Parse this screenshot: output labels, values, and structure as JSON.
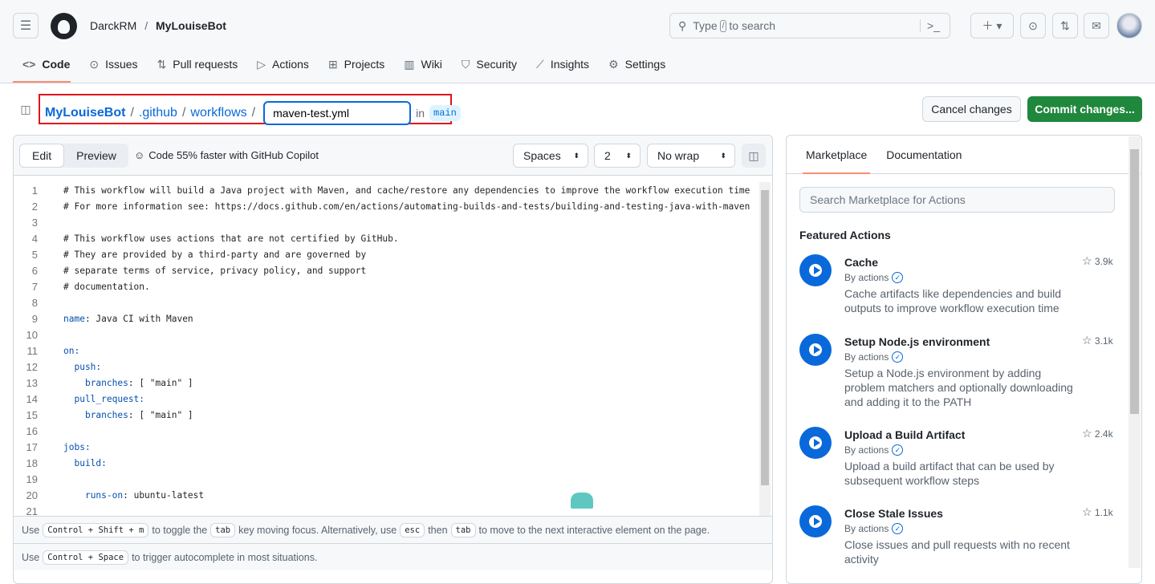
{
  "header": {
    "owner": "DarckRM",
    "repo": "MyLouiseBot",
    "search_pre": "Type",
    "search_key": "/",
    "search_post": "to search"
  },
  "nav": [
    {
      "label": "Code",
      "icon": "code-icon"
    },
    {
      "label": "Issues",
      "icon": "issue-icon"
    },
    {
      "label": "Pull requests",
      "icon": "pull-request-icon"
    },
    {
      "label": "Actions",
      "icon": "play-icon"
    },
    {
      "label": "Projects",
      "icon": "table-icon"
    },
    {
      "label": "Wiki",
      "icon": "book-icon"
    },
    {
      "label": "Security",
      "icon": "shield-icon"
    },
    {
      "label": "Insights",
      "icon": "graph-icon"
    },
    {
      "label": "Settings",
      "icon": "gear-icon"
    }
  ],
  "path": {
    "repo": "MyLouiseBot",
    "dir1": ".github",
    "dir2": "workflows",
    "filename": "maven-test.yml",
    "in": "in",
    "branch": "main"
  },
  "buttons": {
    "cancel": "Cancel changes",
    "commit": "Commit changes..."
  },
  "editor": {
    "edit": "Edit",
    "preview": "Preview",
    "copilot": "Code 55% faster with GitHub Copilot",
    "indent_mode": "Spaces",
    "indent_size": "2",
    "wrap": "No wrap",
    "lines": [
      "# This workflow will build a Java project with Maven, and cache/restore any dependencies to improve the workflow execution time",
      "# For more information see: https://docs.github.com/en/actions/automating-builds-and-tests/building-and-testing-java-with-maven",
      "",
      "# This workflow uses actions that are not certified by GitHub.",
      "# They are provided by a third-party and are governed by",
      "# separate terms of service, privacy policy, and support",
      "# documentation.",
      "",
      "name: Java CI with Maven",
      "",
      "on:",
      "  push:",
      "    branches: [ \"main\" ]",
      "  pull_request:",
      "    branches: [ \"main\" ]",
      "",
      "jobs:",
      "  build:",
      "",
      "    runs-on: ubuntu-latest",
      ""
    ],
    "hint1": {
      "a": "Use",
      "k1": "Control + Shift + m",
      "b": "to toggle the",
      "k2": "tab",
      "c": "key moving focus. Alternatively, use",
      "k3": "esc",
      "d": "then",
      "k4": "tab",
      "e": "to move to the next interactive element on the page."
    },
    "hint2": {
      "a": "Use",
      "k1": "Control + Space",
      "b": "to trigger autocomplete in most situations."
    }
  },
  "sidebar": {
    "tabs": [
      "Marketplace",
      "Documentation"
    ],
    "search_placeholder": "Search Marketplace for Actions",
    "featured": "Featured Actions",
    "actions": [
      {
        "title": "Cache",
        "by": "By actions",
        "desc": "Cache artifacts like dependencies and build outputs to improve workflow execution time",
        "stars": "3.9k"
      },
      {
        "title": "Setup Node.js environment",
        "by": "By actions",
        "desc": "Setup a Node.js environment by adding problem matchers and optionally downloading and adding it to the PATH",
        "stars": "3.1k"
      },
      {
        "title": "Upload a Build Artifact",
        "by": "By actions",
        "desc": "Upload a build artifact that can be used by subsequent workflow steps",
        "stars": "2.4k"
      },
      {
        "title": "Close Stale Issues",
        "by": "By actions",
        "desc": "Close issues and pull requests with no recent activity",
        "stars": "1.1k"
      }
    ]
  },
  "colors": {
    "accent": "#0969da",
    "commit": "#1f883d",
    "highlight_box": "#e0131d",
    "tab_underline": "#fd8c73"
  }
}
